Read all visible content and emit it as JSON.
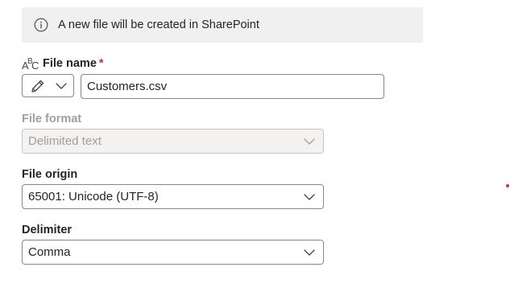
{
  "info": {
    "message": "A new file will be created in SharePoint",
    "icon": "info-icon"
  },
  "file_name": {
    "label": "File name",
    "required_marker": "*",
    "type_icon": "abc-text-icon",
    "mode_icon": "pencil-icon",
    "value": "Customers.csv"
  },
  "file_format": {
    "label": "File format",
    "value": "Delimited text",
    "disabled": true
  },
  "file_origin": {
    "label": "File origin",
    "value": "65001: Unicode (UTF-8)"
  },
  "delimiter": {
    "label": "Delimiter",
    "value": "Comma"
  },
  "colors": {
    "info_bar_bg": "#f0f0f0",
    "required": "#c4314b",
    "border": "#8a8886",
    "disabled_text": "#a19f9d",
    "disabled_bg": "#f3f2f1",
    "marker_dot": "#d13438"
  }
}
